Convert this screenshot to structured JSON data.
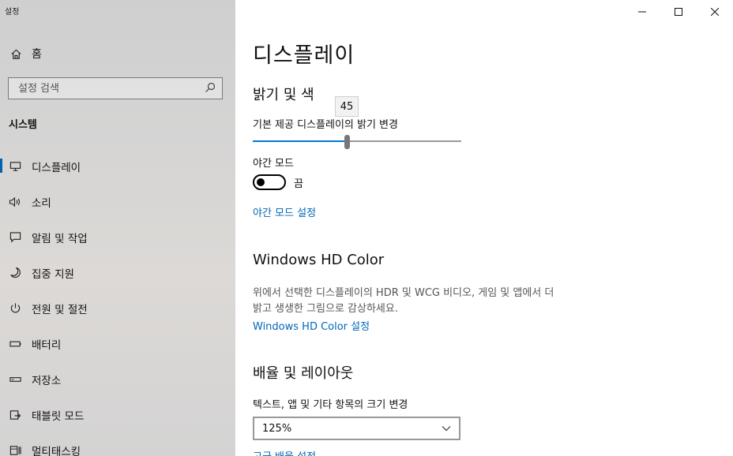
{
  "window": {
    "app_title": "설정",
    "controls": {
      "minimize": "−",
      "maximize": "☐",
      "close": "✕"
    }
  },
  "sidebar": {
    "home_label": "홈",
    "search_placeholder": "설정 검색",
    "section_label": "시스템",
    "items": [
      {
        "label": "디스플레이",
        "icon": "monitor-icon",
        "active": true
      },
      {
        "label": "소리",
        "icon": "speaker-icon",
        "active": false
      },
      {
        "label": "알림 및 작업",
        "icon": "notification-icon",
        "active": false
      },
      {
        "label": "집중 지원",
        "icon": "moon-icon",
        "active": false
      },
      {
        "label": "전원 및 절전",
        "icon": "power-icon",
        "active": false
      },
      {
        "label": "배터리",
        "icon": "battery-icon",
        "active": false
      },
      {
        "label": "저장소",
        "icon": "storage-icon",
        "active": false
      },
      {
        "label": "태블릿 모드",
        "icon": "tablet-icon",
        "active": false
      },
      {
        "label": "멀티태스킹",
        "icon": "multitasking-icon",
        "active": false
      }
    ]
  },
  "main": {
    "page_title": "디스플레이",
    "brightness_section": {
      "heading": "밝기 및 색",
      "slider_label": "기본 제공 디스플레이의 밝기 변경",
      "value": 45,
      "tooltip": "45"
    },
    "night_light": {
      "label": "야간 모드",
      "state": "끔",
      "settings_link": "야간 모드 설정"
    },
    "hd_color": {
      "heading": "Windows HD Color",
      "description_line1": "위에서 선택한 디스플레이의 HDR 및 WCG 비디오, 게임 및 앱에서 더",
      "description_line2": "밝고 생생한 그림으로 감상하세요.",
      "settings_link": "Windows HD Color 설정"
    },
    "scale_layout": {
      "heading": "배율 및 레이아웃",
      "label": "텍스트, 앱 및 기타 항목의 크기 변경",
      "selected": "125%",
      "advanced_link": "고급 배율 설정"
    }
  },
  "colors": {
    "accent": "#0078d4",
    "link": "#0067b8",
    "sidebar_bg": "#d3d2d2"
  }
}
